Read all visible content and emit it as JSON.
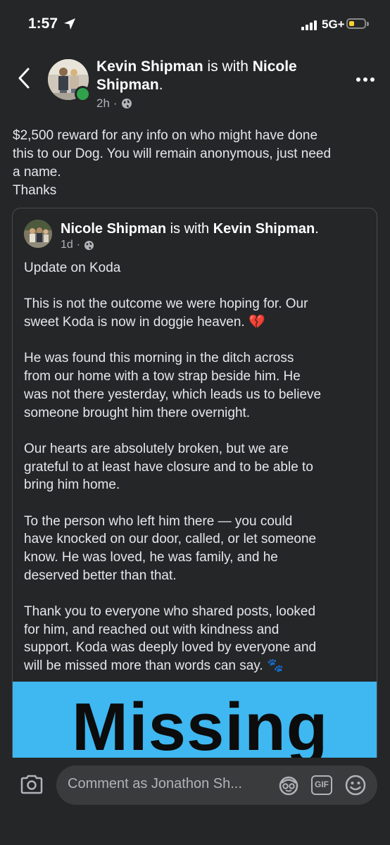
{
  "status_bar": {
    "time": "1:57",
    "network": "5G+",
    "icons": [
      "location-arrow-icon",
      "signal-bars-icon",
      "battery-icon"
    ],
    "battery_color": "#f7d22a"
  },
  "post": {
    "author": "Kevin Shipman",
    "with_text": " is with ",
    "tagged": "Nicole Shipman",
    "period": ".",
    "time_ago": "2h",
    "dot": "·",
    "text_lines": [
      "$2,500 reward for any info on who might have done",
      "this to our Dog. You will remain anonymous, just need",
      "a name.",
      "Thanks"
    ]
  },
  "shared_post": {
    "author": "Nicole Shipman",
    "with_text": " is with ",
    "tagged": "Kevin Shipman",
    "period": ".",
    "time_ago": "1d",
    "dot": "·",
    "paragraphs": [
      [
        "Update on Koda"
      ],
      [
        "This is not the outcome we were hoping for. Our",
        "sweet Koda is now in doggie heaven. 💔"
      ],
      [
        "He was found this morning in the ditch across",
        "from our home with a tow strap beside him. He",
        "was not there yesterday, which leads us to believe",
        "someone brought him there overnight."
      ],
      [
        "Our hearts are absolutely broken, but we are",
        "grateful to at least have closure and to be able to",
        "bring him home."
      ],
      [
        "To the person who left him there — you could",
        "have knocked on our door, called, or let someone",
        "know. He was loved, he was family, and he",
        "deserved better than that."
      ],
      [
        "Thank you to everyone who shared posts, looked",
        "for him, and reached out with kindness and",
        "support. Koda was deeply loved by everyone and",
        "will be missed more than words can say. 🐾"
      ]
    ],
    "banner_text": "Missing",
    "banner_color": "#3fb7f0"
  },
  "comment_bar": {
    "placeholder": "Comment as Jonathon Sh...",
    "gif_label": "GIF",
    "icons": [
      "camera-icon",
      "avatar-sticker-icon",
      "gif-icon",
      "emoji-icon"
    ]
  },
  "colors": {
    "background": "#252628",
    "text": "#e4e6eb",
    "muted": "#b0b3b8",
    "online": "#31a24c"
  }
}
